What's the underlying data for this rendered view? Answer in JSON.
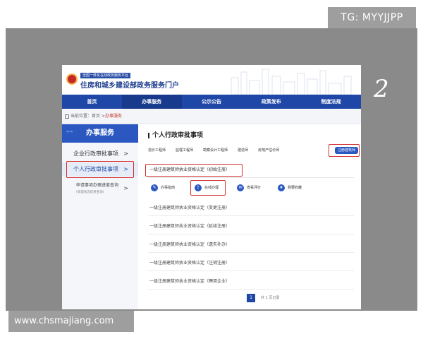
{
  "watermark_top": "TG: MYYJJPP",
  "watermark_bottom": "www.chsmajiang.com",
  "step_number": "2",
  "portal": {
    "tag": "全国一体化在线政务服务平台",
    "title": "住房和城乡建设部政务服务门户"
  },
  "nav": [
    "首页",
    "办事服务",
    "公示公告",
    "政策发布",
    "制度法规"
  ],
  "nav_active": 1,
  "breadcrumb": {
    "prefix": "当前位置：首页 >",
    "current": "办事服务"
  },
  "sidebar": {
    "heading": "办事服务",
    "items": [
      {
        "label": "企业行政审批事项",
        "arrow": ">"
      },
      {
        "label": "个人行政审批事项",
        "arrow": ">"
      },
      {
        "label": "申请事项办理进度查询",
        "sub": "(受理状态结果查询)",
        "arrow": ">"
      }
    ]
  },
  "content": {
    "title": "个人行政审批事项",
    "subtabs": [
      "造价工程师",
      "监理工程师",
      "勘察设计工程师",
      "建造师",
      "房地产估价师",
      "注册建筑师"
    ],
    "selected_subtab": 5,
    "active_item": "一级注册建筑师执业资格认定（初始注册）",
    "actions": [
      {
        "label": "办事指南",
        "icon": "compass-icon",
        "glyph": "✎"
      },
      {
        "label": "在线办理",
        "icon": "upload-icon",
        "glyph": "⇪"
      },
      {
        "label": "查看评价",
        "icon": "comment-icon",
        "glyph": "✉"
      },
      {
        "label": "我要收藏",
        "icon": "star-icon",
        "glyph": "★"
      }
    ],
    "list": [
      "一级注册建筑师执业资格认定（变更注册）",
      "一级注册建筑师执业资格认定（延续注册）",
      "一级注册建筑师执业资格认定（遗失补办）",
      "一级注册建筑师执业资格认定（注销注册）",
      "一级注册建筑师执业资格认定（聘用企业）"
    ],
    "pager": {
      "page": "1",
      "total": "共 1 页记录"
    }
  },
  "colors": {
    "nav_blue": "#1f47a8",
    "highlight_red": "#d32f2f",
    "backdrop_gray": "#8a8a8a"
  }
}
